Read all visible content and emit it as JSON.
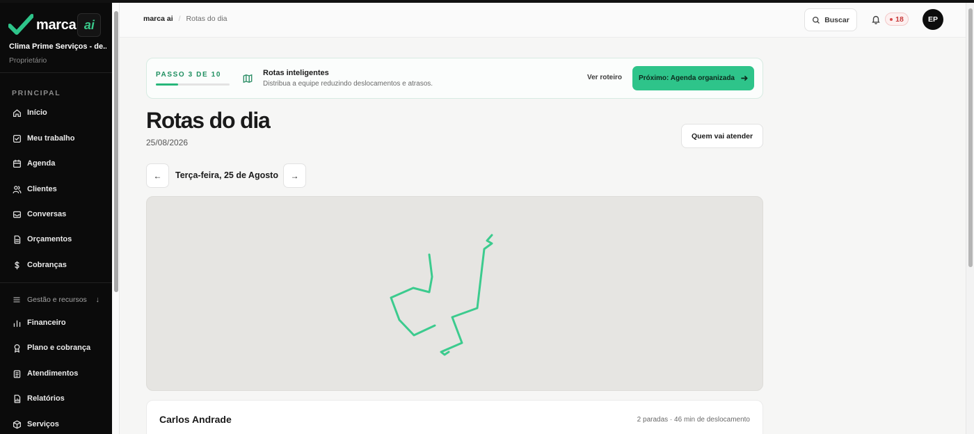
{
  "brand": {
    "word": "marca",
    "ai": "ai"
  },
  "account": {
    "company": "Clima Prime Serviços - de...",
    "role": "Proprietário"
  },
  "sidebar": {
    "section_title": "PRINCIPAL",
    "main_items": [
      {
        "label": "Início",
        "icon": "home-icon"
      },
      {
        "label": "Meu trabalho",
        "icon": "checkbox-icon"
      },
      {
        "label": "Agenda",
        "icon": "calendar-icon"
      },
      {
        "label": "Clientes",
        "icon": "users-icon"
      },
      {
        "label": "Conversas",
        "icon": "inbox-icon"
      },
      {
        "label": "Orçamentos",
        "icon": "document-icon"
      },
      {
        "label": "Cobranças",
        "icon": "dollar-icon"
      }
    ],
    "group_label": "Gestão e recursos",
    "group_items": [
      {
        "label": "Financeiro",
        "icon": "bar-chart-icon"
      },
      {
        "label": "Plano e cobrança",
        "icon": "award-icon"
      },
      {
        "label": "Atendimentos",
        "icon": "clipboard-icon"
      },
      {
        "label": "Relatórios",
        "icon": "report-icon"
      },
      {
        "label": "Serviços",
        "icon": "box-icon"
      }
    ]
  },
  "header": {
    "breadcrumb_home": "marca ai",
    "breadcrumb_sep": "/",
    "breadcrumb_current": "Rotas do dia",
    "search_label": "Buscar",
    "notification_count": "18",
    "avatar_initials": "EP"
  },
  "step": {
    "label": "PASSO 3 DE 10",
    "progress": 0.3,
    "title": "Rotas inteligentes",
    "subtitle": "Distribua a equipe reduzindo deslocamentos e atrasos.",
    "view_label": "Ver roteiro",
    "next_label": "Próximo: Agenda organizada"
  },
  "page": {
    "title": "Rotas do dia",
    "date": "25/08/2026",
    "who_button": "Quem vai atender",
    "prev_arrow": "←",
    "next_arrow": "→",
    "day_label": "Terça-feira, 25 de Agosto"
  },
  "map": {
    "route_color": "#3ccb8e",
    "background": "#e6e5e2"
  },
  "technicians": [
    {
      "name": "Carlos Andrade",
      "meta": "2 paradas · 46 min de deslocamento"
    }
  ],
  "colors": {
    "accent": "#2ec48a",
    "sidebar_bg": "#0b0b0b",
    "badge_red": "#c63a3a"
  }
}
